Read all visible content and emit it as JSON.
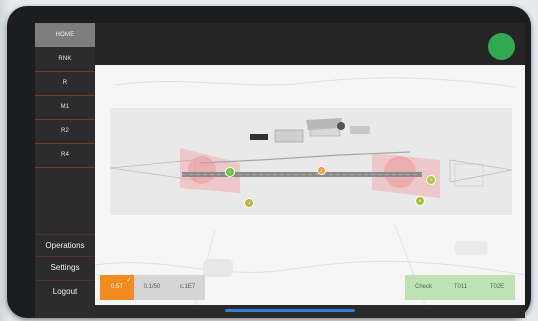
{
  "sidebar": {
    "items": [
      {
        "label": "HOME",
        "active": true
      },
      {
        "label": "RNK",
        "active": false
      },
      {
        "label": "R",
        "active": false
      },
      {
        "label": "M1",
        "active": false
      },
      {
        "label": "R2",
        "active": false
      },
      {
        "label": "R4",
        "active": false
      }
    ],
    "bottom": [
      {
        "label": "Operations"
      },
      {
        "label": "Settings"
      },
      {
        "label": "Logout"
      }
    ]
  },
  "status": {
    "color": "#32a853"
  },
  "markers": [
    {
      "label": "1"
    },
    {
      "label": "2"
    },
    {
      "label": "3"
    },
    {
      "label": "4"
    },
    {
      "label": "5"
    }
  ],
  "bottom_left_buttons": [
    {
      "label": "0.5T",
      "selected": true
    },
    {
      "label": "0.1/50",
      "selected": false
    },
    {
      "label": "c.1E7",
      "selected": false
    }
  ],
  "bottom_right_buttons": [
    {
      "label": "Check"
    },
    {
      "label": "T011"
    },
    {
      "label": "T02E"
    }
  ]
}
